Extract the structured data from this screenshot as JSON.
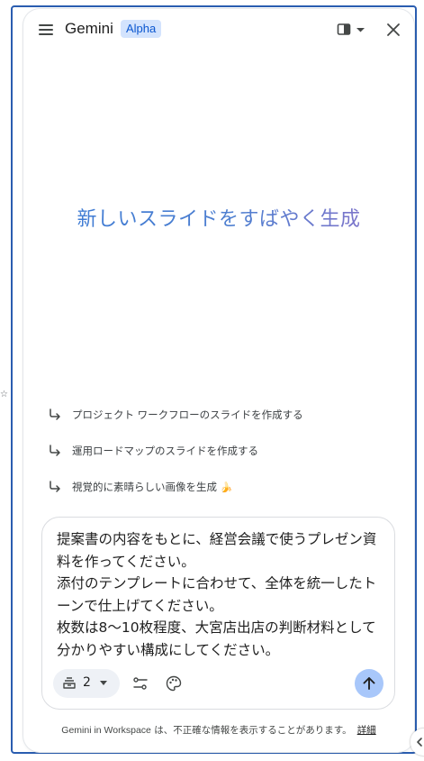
{
  "header": {
    "title": "Gemini",
    "badge": "Alpha",
    "menu_icon": "hamburger-menu-icon",
    "layout_icon": "panel-layout-icon",
    "close_icon": "close-icon"
  },
  "hero": {
    "title": "新しいスライドをすばやく生成"
  },
  "suggestions": [
    {
      "label": "プロジェクト ワークフローのスライドを作成する",
      "icon": "arrow-return-icon"
    },
    {
      "label": "運用ロードマップのスライドを作成する",
      "icon": "arrow-return-icon"
    },
    {
      "label": "視覚的に素晴らしい画像を生成",
      "icon": "arrow-return-icon",
      "emoji": "🍌"
    }
  ],
  "prompt": {
    "text": "提案書の内容をもとに、経営会議で使うプレゼン資料を作ってください。\n添付のテンプレートに合わせて、全体を統一したトーンで仕上げてください。\n枚数は8〜10枚程度、大宮店出店の判断材料として分かりやすい構成にしてください。"
  },
  "toolbar": {
    "attachment_count": "2",
    "stack_icon": "stack-icon",
    "tools_icon": "tune-icon",
    "palette_icon": "palette-icon",
    "send_icon": "arrow-up-icon"
  },
  "footer": {
    "brand": "Gemini in Workspace",
    "notice": " は、不正確な情報を表示することがあります。",
    "details_link": "詳細"
  },
  "page_edge": {
    "star": "☆"
  },
  "colors": {
    "accent": "#0b57d0",
    "badge_bg": "#d3e3fd",
    "send_bg": "#a8c7fa",
    "frame_border": "#2a5db0"
  }
}
